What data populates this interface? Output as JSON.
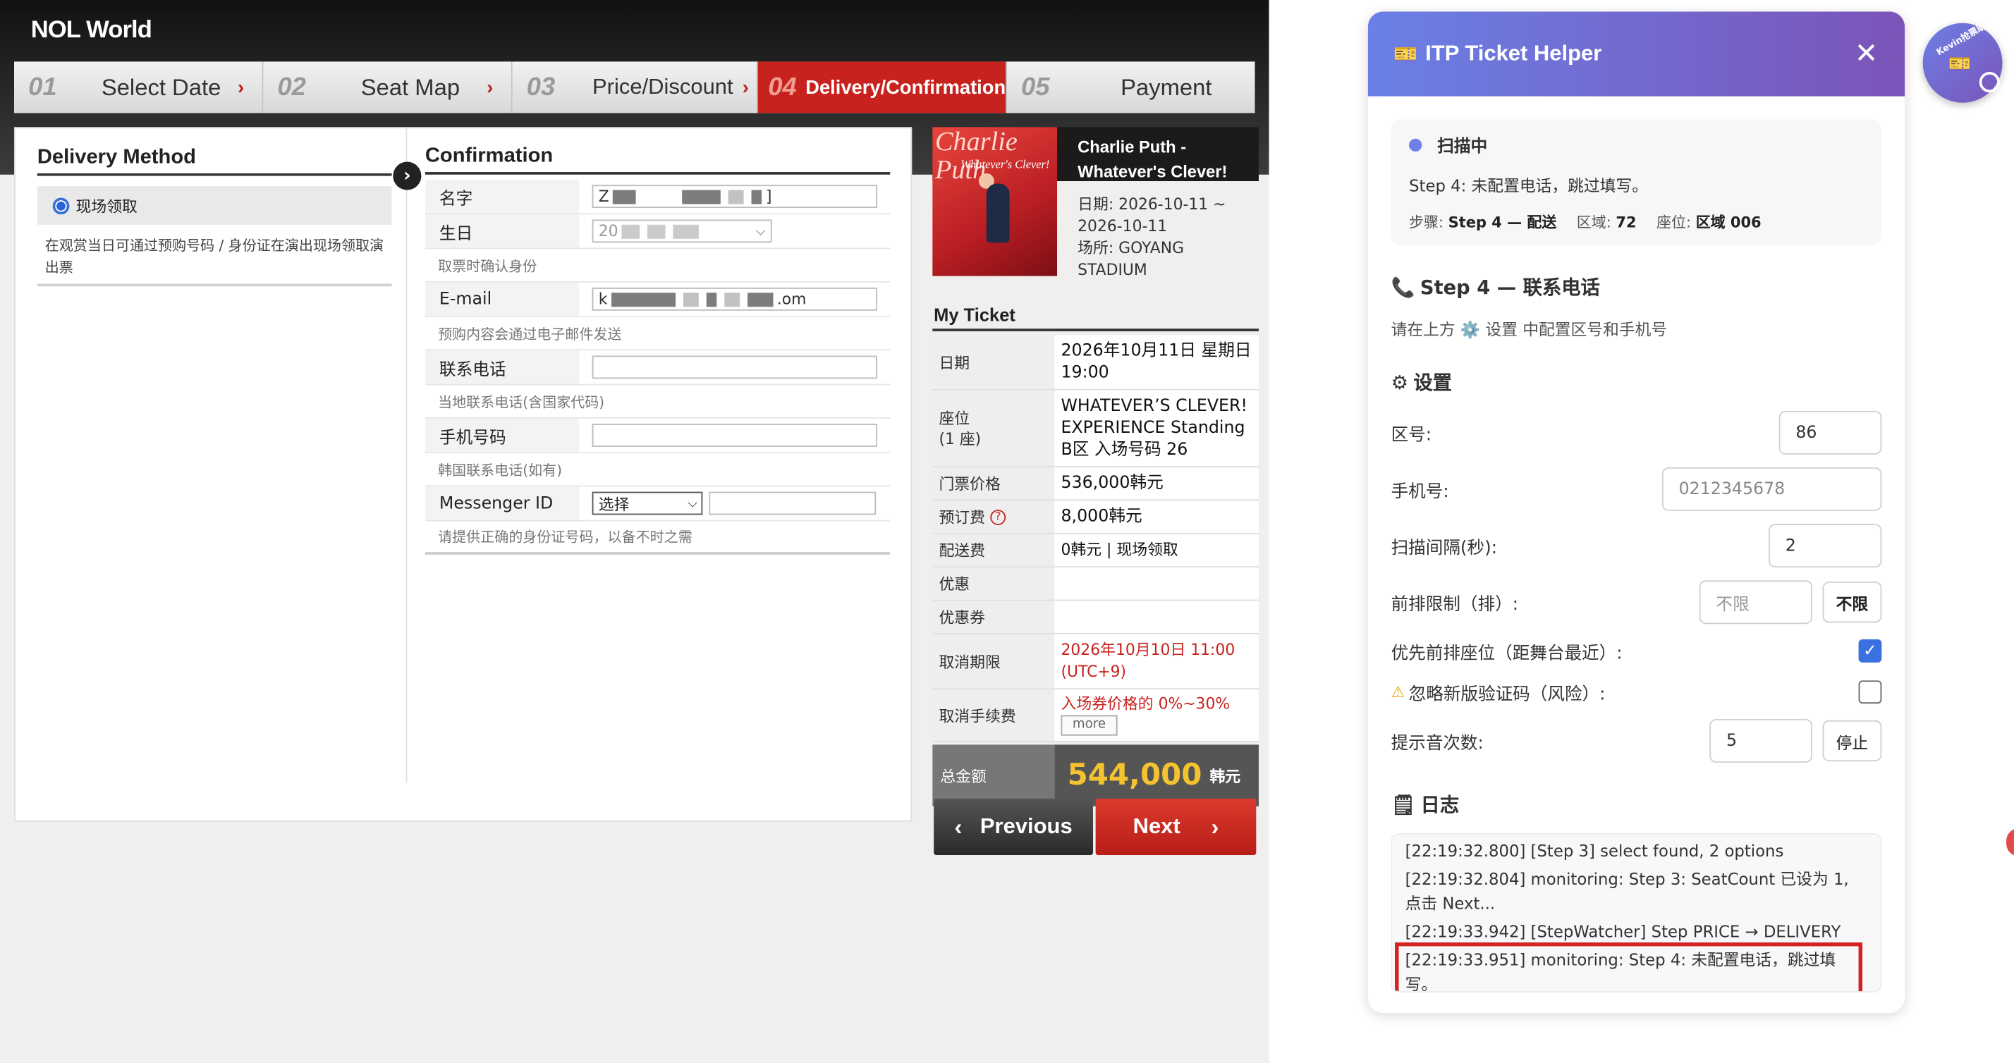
{
  "site": {
    "logo": "NOL World",
    "steps": [
      {
        "num": "01",
        "label": "Select Date"
      },
      {
        "num": "02",
        "label": "Seat Map"
      },
      {
        "num": "03",
        "label": "Price/Discount"
      },
      {
        "num": "04",
        "label": "Delivery/Confirmation"
      },
      {
        "num": "05",
        "label": "Payment"
      }
    ],
    "delivery": {
      "title": "Delivery Method",
      "option": "现场领取",
      "desc": "在观赏当日可通过预购号码 / 身份证在演出现场领取演出票"
    },
    "confirmation": {
      "title": "Confirmation",
      "name_label": "名字",
      "name_value_start": "Z",
      "name_value_end": "]",
      "birth_label": "生日",
      "birth_value_start": "20",
      "birth_hint": "取票时确认身份",
      "email_label": "E-mail",
      "email_value_start": "k",
      "email_value_end": ".om",
      "email_hint": "预购内容会通过电子邮件发送",
      "phone_label": "联系电话",
      "phone_hint": "当地联系电话(含国家代码)",
      "mobile_label": "手机号码",
      "mobile_hint": "韩国联系电话(如有)",
      "messenger_label": "Messenger ID",
      "messenger_select": "选择",
      "final_hint": "请提供正确的身份证号码，以备不时之需"
    },
    "performance": {
      "poster_title": "Charlie Puth",
      "poster_sub": "Whatever's Clever!",
      "title": "Charlie Puth - Whatever's Clever!",
      "date_line": "日期: 2026-10-11 ~ 2026-10-11",
      "venue_line": "场所: GOYANG STADIUM"
    },
    "my_ticket": {
      "title": "My Ticket",
      "rows": {
        "date_label": "日期",
        "date_value": "2026年10月11日 星期日 19:00",
        "seat_label": "座位\n(1 座)",
        "seat_value": "WHATEVER’S CLEVER! EXPERIENCE Standing B区 入场号码 26",
        "price_label": "门票价格",
        "price_value": "536,000韩元",
        "fee_label": "预订费",
        "fee_icon": "?",
        "fee_value": "8,000韩元",
        "delivery_label": "配送费",
        "delivery_value": "0韩元 | 现场领取",
        "discount_label": "优惠",
        "coupon_label": "优惠券",
        "cancel_deadline_label": "取消期限",
        "cancel_deadline_value": "2026年10月10日 11:00 (UTC+9)",
        "cancel_fee_label": "取消手续费",
        "cancel_fee_value": "入场券价格的 0%~30%",
        "more": "more"
      },
      "total_label": "总金额",
      "total_amount": "544,000",
      "total_currency": "韩元"
    },
    "buttons": {
      "previous": "Previous",
      "next": "Next"
    }
  },
  "extension": {
    "title": "ITP Ticket Helper",
    "close": "✕",
    "status": {
      "state": "扫描中",
      "message": "Step 4: 未配置电话，跳过填写。",
      "step_label": "步骤:",
      "step_value": "Step 4 — 配送",
      "area_label": "区域:",
      "area_value": "72",
      "seat_label": "座位:",
      "seat_value": "区域 006"
    },
    "step_heading": "Step 4 — 联系电话",
    "step_sub": "请在上方 ⚙️ 设置 中配置区号和手机号",
    "settings_heading": "设置",
    "settings": {
      "area_code_label": "区号:",
      "area_code_value": "86",
      "phone_label": "手机号:",
      "phone_placeholder": "0212345678",
      "interval_label": "扫描间隔(秒):",
      "interval_value": "2",
      "row_limit_label": "前排限制（排）:",
      "row_limit_placeholder": "不限",
      "row_limit_button": "不限",
      "front_priority_label": "优先前排座位（距舞台最近）:",
      "front_priority_checked": true,
      "ignore_captcha_label": "忽略新版验证码（风险）:",
      "ignore_captcha_checked": false,
      "alert_count_label": "提示音次数:",
      "alert_count_value": "5",
      "stop_button": "停止"
    },
    "log_heading": "日志",
    "logs": [
      "[22:19:32.800] [Step 3] select found, 2 options",
      "[22:19:32.804] monitoring: Step 3: SeatCount 已设为 1, 点击 Next...",
      "[22:19:33.942] [StepWatcher] Step PRICE → DELIVERY",
      "[22:19:33.951] monitoring: Step 4: 未配置电话，跳过填写。"
    ]
  },
  "fab": {
    "label": "Kevin抢票助手"
  },
  "colors": {
    "accent_start": "#6a80e6",
    "accent_end": "#7b54b8",
    "site_red": "#c8221f",
    "total_yellow": "#f5c230"
  }
}
